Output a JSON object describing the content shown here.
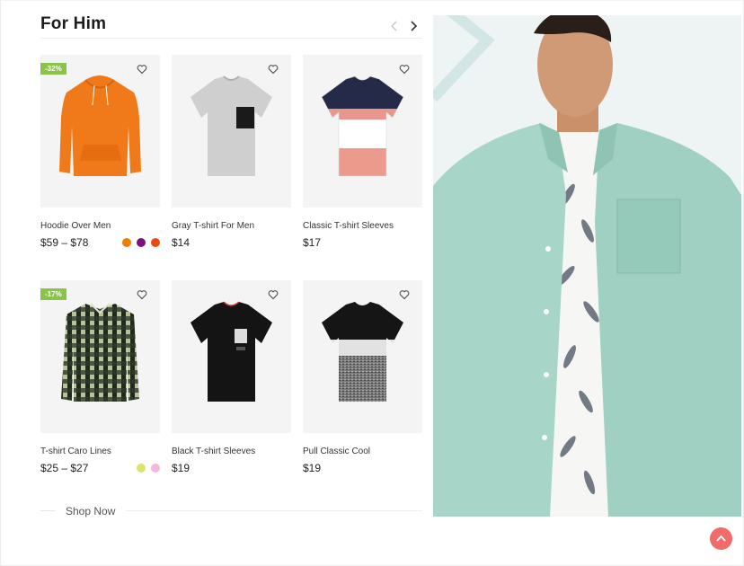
{
  "section": {
    "title": "For Him",
    "shop_now_label": "Shop Now"
  },
  "nav": {
    "prev_icon": "chevron-left-icon",
    "next_icon": "chevron-right-icon"
  },
  "products": [
    {
      "name": "Hoodie Over Men",
      "price": "$59 – $78",
      "badge": "-32%",
      "swatches": [
        "#f07c00",
        "#7b1080",
        "#ee4b0e"
      ]
    },
    {
      "name": "Gray T-shirt For Men",
      "price": "$14"
    },
    {
      "name": "Classic T-shirt Sleeves",
      "price": "$17"
    },
    {
      "name": "T-shirt Caro Lines",
      "price": "$25 – $27",
      "badge": "-17%",
      "swatches": [
        "#dde46a",
        "#f4b8dc"
      ]
    },
    {
      "name": "Black T-shirt Sleeves",
      "price": "$19"
    },
    {
      "name": "Pull Classic Cool",
      "price": "$19"
    }
  ],
  "colors": {
    "badge": "#8bc34a",
    "scroll_top": "#f26b6b",
    "banner_shirt": "#a7d5c8"
  }
}
